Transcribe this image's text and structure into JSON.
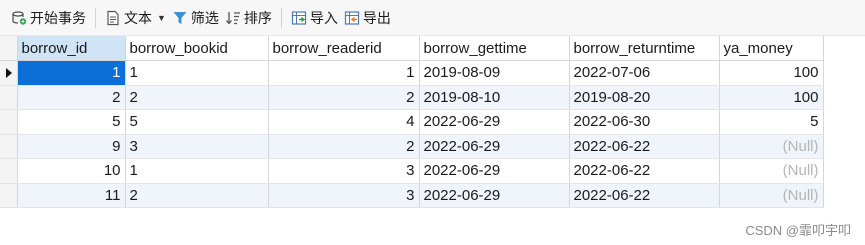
{
  "toolbar": {
    "begin_transaction": "开始事务",
    "text": "文本",
    "filter": "筛选",
    "sort": "排序",
    "import": "导入",
    "export": "导出"
  },
  "table": {
    "columns": [
      "borrow_id",
      "borrow_bookid",
      "borrow_readerid",
      "borrow_gettime",
      "borrow_returntime",
      "ya_money"
    ],
    "rows": [
      [
        "1",
        "1",
        "1",
        "2019-08-09",
        "2022-07-06",
        "100"
      ],
      [
        "2",
        "2",
        "2",
        "2019-08-10",
        "2019-08-20",
        "100"
      ],
      [
        "5",
        "5",
        "4",
        "2022-06-29",
        "2022-06-30",
        "5"
      ],
      [
        "9",
        "3",
        "2",
        "2022-06-29",
        "2022-06-22",
        "(Null)"
      ],
      [
        "10",
        "1",
        "3",
        "2022-06-29",
        "2022-06-22",
        "(Null)"
      ],
      [
        "11",
        "2",
        "3",
        "2022-06-29",
        "2022-06-22",
        "(Null)"
      ]
    ]
  },
  "watermark": "CSDN @霏叩宇叩",
  "colors": {
    "selection": "#0a6fd6",
    "active_header": "#cfe4f7",
    "alt_row": "#f0f5fb",
    "null_text": "#b5b5b5"
  },
  "icons": {
    "begin_transaction": "transaction-icon",
    "text": "document-icon",
    "filter": "funnel-icon",
    "sort": "sort-icon",
    "import": "import-icon",
    "export": "export-icon"
  }
}
